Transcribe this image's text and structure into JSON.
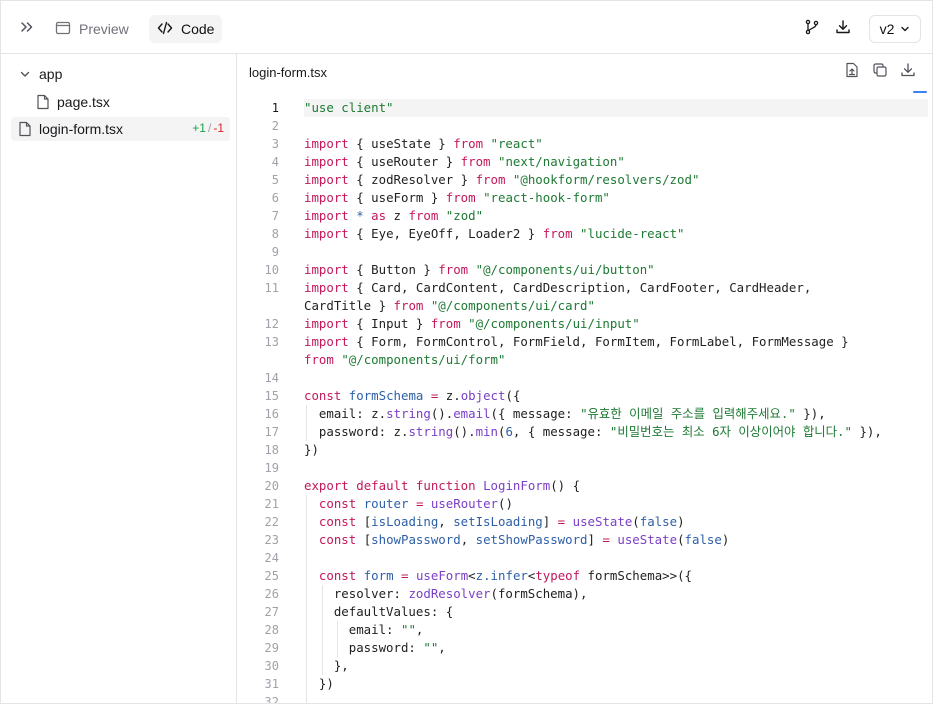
{
  "topbar": {
    "preview_label": "Preview",
    "code_label": "Code",
    "version_label": "v2",
    "icons": [
      "chevrons-right-icon",
      "panel-icon",
      "code-icon",
      "git-branch-icon",
      "download-icon",
      "chevron-down-icon"
    ]
  },
  "sidebar": {
    "folder": "app",
    "files": [
      {
        "name": "page.tsx"
      },
      {
        "name": "login-form.tsx",
        "selected": true,
        "additions": "+1",
        "separator": "/",
        "deletions": "-1"
      }
    ]
  },
  "editor": {
    "file_name": "login-form.tsx",
    "active_line": 1,
    "lines": [
      {
        "n": "1",
        "tokens": [
          [
            "str",
            "\"use client\""
          ]
        ]
      },
      {
        "n": "2",
        "tokens": []
      },
      {
        "n": "3",
        "tokens": [
          [
            "kw",
            "import"
          ],
          [
            "pl",
            " { useState } "
          ],
          [
            "kw",
            "from"
          ],
          [
            "pl",
            " "
          ],
          [
            "str",
            "\"react\""
          ]
        ]
      },
      {
        "n": "4",
        "tokens": [
          [
            "kw",
            "import"
          ],
          [
            "pl",
            " { useRouter } "
          ],
          [
            "kw",
            "from"
          ],
          [
            "pl",
            " "
          ],
          [
            "str",
            "\"next/navigation\""
          ]
        ]
      },
      {
        "n": "5",
        "tokens": [
          [
            "kw",
            "import"
          ],
          [
            "pl",
            " { zodResolver } "
          ],
          [
            "kw",
            "from"
          ],
          [
            "pl",
            " "
          ],
          [
            "str",
            "\"@hookform/resolvers/zod\""
          ]
        ]
      },
      {
        "n": "6",
        "tokens": [
          [
            "kw",
            "import"
          ],
          [
            "pl",
            " { useForm } "
          ],
          [
            "kw",
            "from"
          ],
          [
            "pl",
            " "
          ],
          [
            "str",
            "\"react-hook-form\""
          ]
        ]
      },
      {
        "n": "7",
        "tokens": [
          [
            "kw",
            "import"
          ],
          [
            "pl",
            " "
          ],
          [
            "var",
            "*"
          ],
          [
            "pl",
            " "
          ],
          [
            "kw",
            "as"
          ],
          [
            "pl",
            " z "
          ],
          [
            "kw",
            "from"
          ],
          [
            "pl",
            " "
          ],
          [
            "str",
            "\"zod\""
          ]
        ]
      },
      {
        "n": "8",
        "tokens": [
          [
            "kw",
            "import"
          ],
          [
            "pl",
            " { Eye, EyeOff, Loader2 } "
          ],
          [
            "kw",
            "from"
          ],
          [
            "pl",
            " "
          ],
          [
            "str",
            "\"lucide-react\""
          ]
        ]
      },
      {
        "n": "9",
        "tokens": []
      },
      {
        "n": "10",
        "tokens": [
          [
            "kw",
            "import"
          ],
          [
            "pl",
            " { Button } "
          ],
          [
            "kw",
            "from"
          ],
          [
            "pl",
            " "
          ],
          [
            "str",
            "\"@/components/ui/button\""
          ]
        ]
      },
      {
        "n": "11",
        "tokens": [
          [
            "kw",
            "import"
          ],
          [
            "pl",
            " { Card, CardContent, CardDescription, CardFooter, CardHeader,"
          ]
        ]
      },
      {
        "n": "",
        "tokens": [
          [
            "pl",
            "CardTitle } "
          ],
          [
            "kw",
            "from"
          ],
          [
            "pl",
            " "
          ],
          [
            "str",
            "\"@/components/ui/card\""
          ]
        ]
      },
      {
        "n": "12",
        "tokens": [
          [
            "kw",
            "import"
          ],
          [
            "pl",
            " { Input } "
          ],
          [
            "kw",
            "from"
          ],
          [
            "pl",
            " "
          ],
          [
            "str",
            "\"@/components/ui/input\""
          ]
        ]
      },
      {
        "n": "13",
        "tokens": [
          [
            "kw",
            "import"
          ],
          [
            "pl",
            " { Form, FormControl, FormField, FormItem, FormLabel, FormMessage }"
          ]
        ]
      },
      {
        "n": "",
        "tokens": [
          [
            "kw",
            "from"
          ],
          [
            "pl",
            " "
          ],
          [
            "str",
            "\"@/components/ui/form\""
          ]
        ]
      },
      {
        "n": "14",
        "tokens": []
      },
      {
        "n": "15",
        "tokens": [
          [
            "kw",
            "const"
          ],
          [
            "pl",
            " "
          ],
          [
            "var",
            "formSchema"
          ],
          [
            "pl",
            " "
          ],
          [
            "kw",
            "="
          ],
          [
            "pl",
            " z."
          ],
          [
            "fn",
            "object"
          ],
          [
            "pl",
            "({"
          ]
        ]
      },
      {
        "n": "16",
        "indent": 1,
        "tokens": [
          [
            "pl",
            "  email: z."
          ],
          [
            "fn",
            "string"
          ],
          [
            "pl",
            "()."
          ],
          [
            "fn",
            "email"
          ],
          [
            "pl",
            "({ message: "
          ],
          [
            "str",
            "\"유효한 이메일 주소를 입력해주세요.\""
          ],
          [
            "pl",
            " }),"
          ]
        ]
      },
      {
        "n": "17",
        "indent": 1,
        "tokens": [
          [
            "pl",
            "  password: z."
          ],
          [
            "fn",
            "string"
          ],
          [
            "pl",
            "()."
          ],
          [
            "fn",
            "min"
          ],
          [
            "pl",
            "("
          ],
          [
            "var",
            "6"
          ],
          [
            "pl",
            ", { message: "
          ],
          [
            "str",
            "\"비밀번호는 최소 6자 이상이어야 합니다.\""
          ],
          [
            "pl",
            " }),"
          ]
        ]
      },
      {
        "n": "18",
        "tokens": [
          [
            "pl",
            "})"
          ]
        ]
      },
      {
        "n": "19",
        "tokens": []
      },
      {
        "n": "20",
        "tokens": [
          [
            "kw",
            "export"
          ],
          [
            "pl",
            " "
          ],
          [
            "kw",
            "default"
          ],
          [
            "pl",
            " "
          ],
          [
            "kw",
            "function"
          ],
          [
            "pl",
            " "
          ],
          [
            "fn",
            "LoginForm"
          ],
          [
            "pl",
            "() {"
          ]
        ]
      },
      {
        "n": "21",
        "indent": 1,
        "tokens": [
          [
            "pl",
            "  "
          ],
          [
            "kw",
            "const"
          ],
          [
            "pl",
            " "
          ],
          [
            "var",
            "router"
          ],
          [
            "pl",
            " "
          ],
          [
            "kw",
            "="
          ],
          [
            "pl",
            " "
          ],
          [
            "fn",
            "useRouter"
          ],
          [
            "pl",
            "()"
          ]
        ]
      },
      {
        "n": "22",
        "indent": 1,
        "tokens": [
          [
            "pl",
            "  "
          ],
          [
            "kw",
            "const"
          ],
          [
            "pl",
            " ["
          ],
          [
            "var",
            "isLoading"
          ],
          [
            "pl",
            ", "
          ],
          [
            "var",
            "setIsLoading"
          ],
          [
            "pl",
            "] "
          ],
          [
            "kw",
            "="
          ],
          [
            "pl",
            " "
          ],
          [
            "fn",
            "useState"
          ],
          [
            "pl",
            "("
          ],
          [
            "var",
            "false"
          ],
          [
            "pl",
            ")"
          ]
        ]
      },
      {
        "n": "23",
        "indent": 1,
        "tokens": [
          [
            "pl",
            "  "
          ],
          [
            "kw",
            "const"
          ],
          [
            "pl",
            " ["
          ],
          [
            "var",
            "showPassword"
          ],
          [
            "pl",
            ", "
          ],
          [
            "var",
            "setShowPassword"
          ],
          [
            "pl",
            "] "
          ],
          [
            "kw",
            "="
          ],
          [
            "pl",
            " "
          ],
          [
            "fn",
            "useState"
          ],
          [
            "pl",
            "("
          ],
          [
            "var",
            "false"
          ],
          [
            "pl",
            ")"
          ]
        ]
      },
      {
        "n": "24",
        "indent": 1,
        "tokens": []
      },
      {
        "n": "25",
        "indent": 1,
        "tokens": [
          [
            "pl",
            "  "
          ],
          [
            "kw",
            "const"
          ],
          [
            "pl",
            " "
          ],
          [
            "var",
            "form"
          ],
          [
            "pl",
            " "
          ],
          [
            "kw",
            "="
          ],
          [
            "pl",
            " "
          ],
          [
            "fn",
            "useForm"
          ],
          [
            "pl",
            "<"
          ],
          [
            "ty",
            "z.infer"
          ],
          [
            "pl",
            "<"
          ],
          [
            "kw",
            "typeof"
          ],
          [
            "pl",
            " formSchema>>({"
          ]
        ]
      },
      {
        "n": "26",
        "indent": 2,
        "tokens": [
          [
            "pl",
            "    resolver: "
          ],
          [
            "fn",
            "zodResolver"
          ],
          [
            "pl",
            "(formSchema),"
          ]
        ]
      },
      {
        "n": "27",
        "indent": 2,
        "tokens": [
          [
            "pl",
            "    defaultValues: {"
          ]
        ]
      },
      {
        "n": "28",
        "indent": 3,
        "tokens": [
          [
            "pl",
            "      email: "
          ],
          [
            "str",
            "\"\""
          ],
          [
            "pl",
            ","
          ]
        ]
      },
      {
        "n": "29",
        "indent": 3,
        "tokens": [
          [
            "pl",
            "      password: "
          ],
          [
            "str",
            "\"\""
          ],
          [
            "pl",
            ","
          ]
        ]
      },
      {
        "n": "30",
        "indent": 2,
        "tokens": [
          [
            "pl",
            "    },"
          ]
        ]
      },
      {
        "n": "31",
        "indent": 1,
        "tokens": [
          [
            "pl",
            "  })"
          ]
        ]
      },
      {
        "n": "32",
        "indent": 1,
        "tokens": []
      }
    ]
  }
}
